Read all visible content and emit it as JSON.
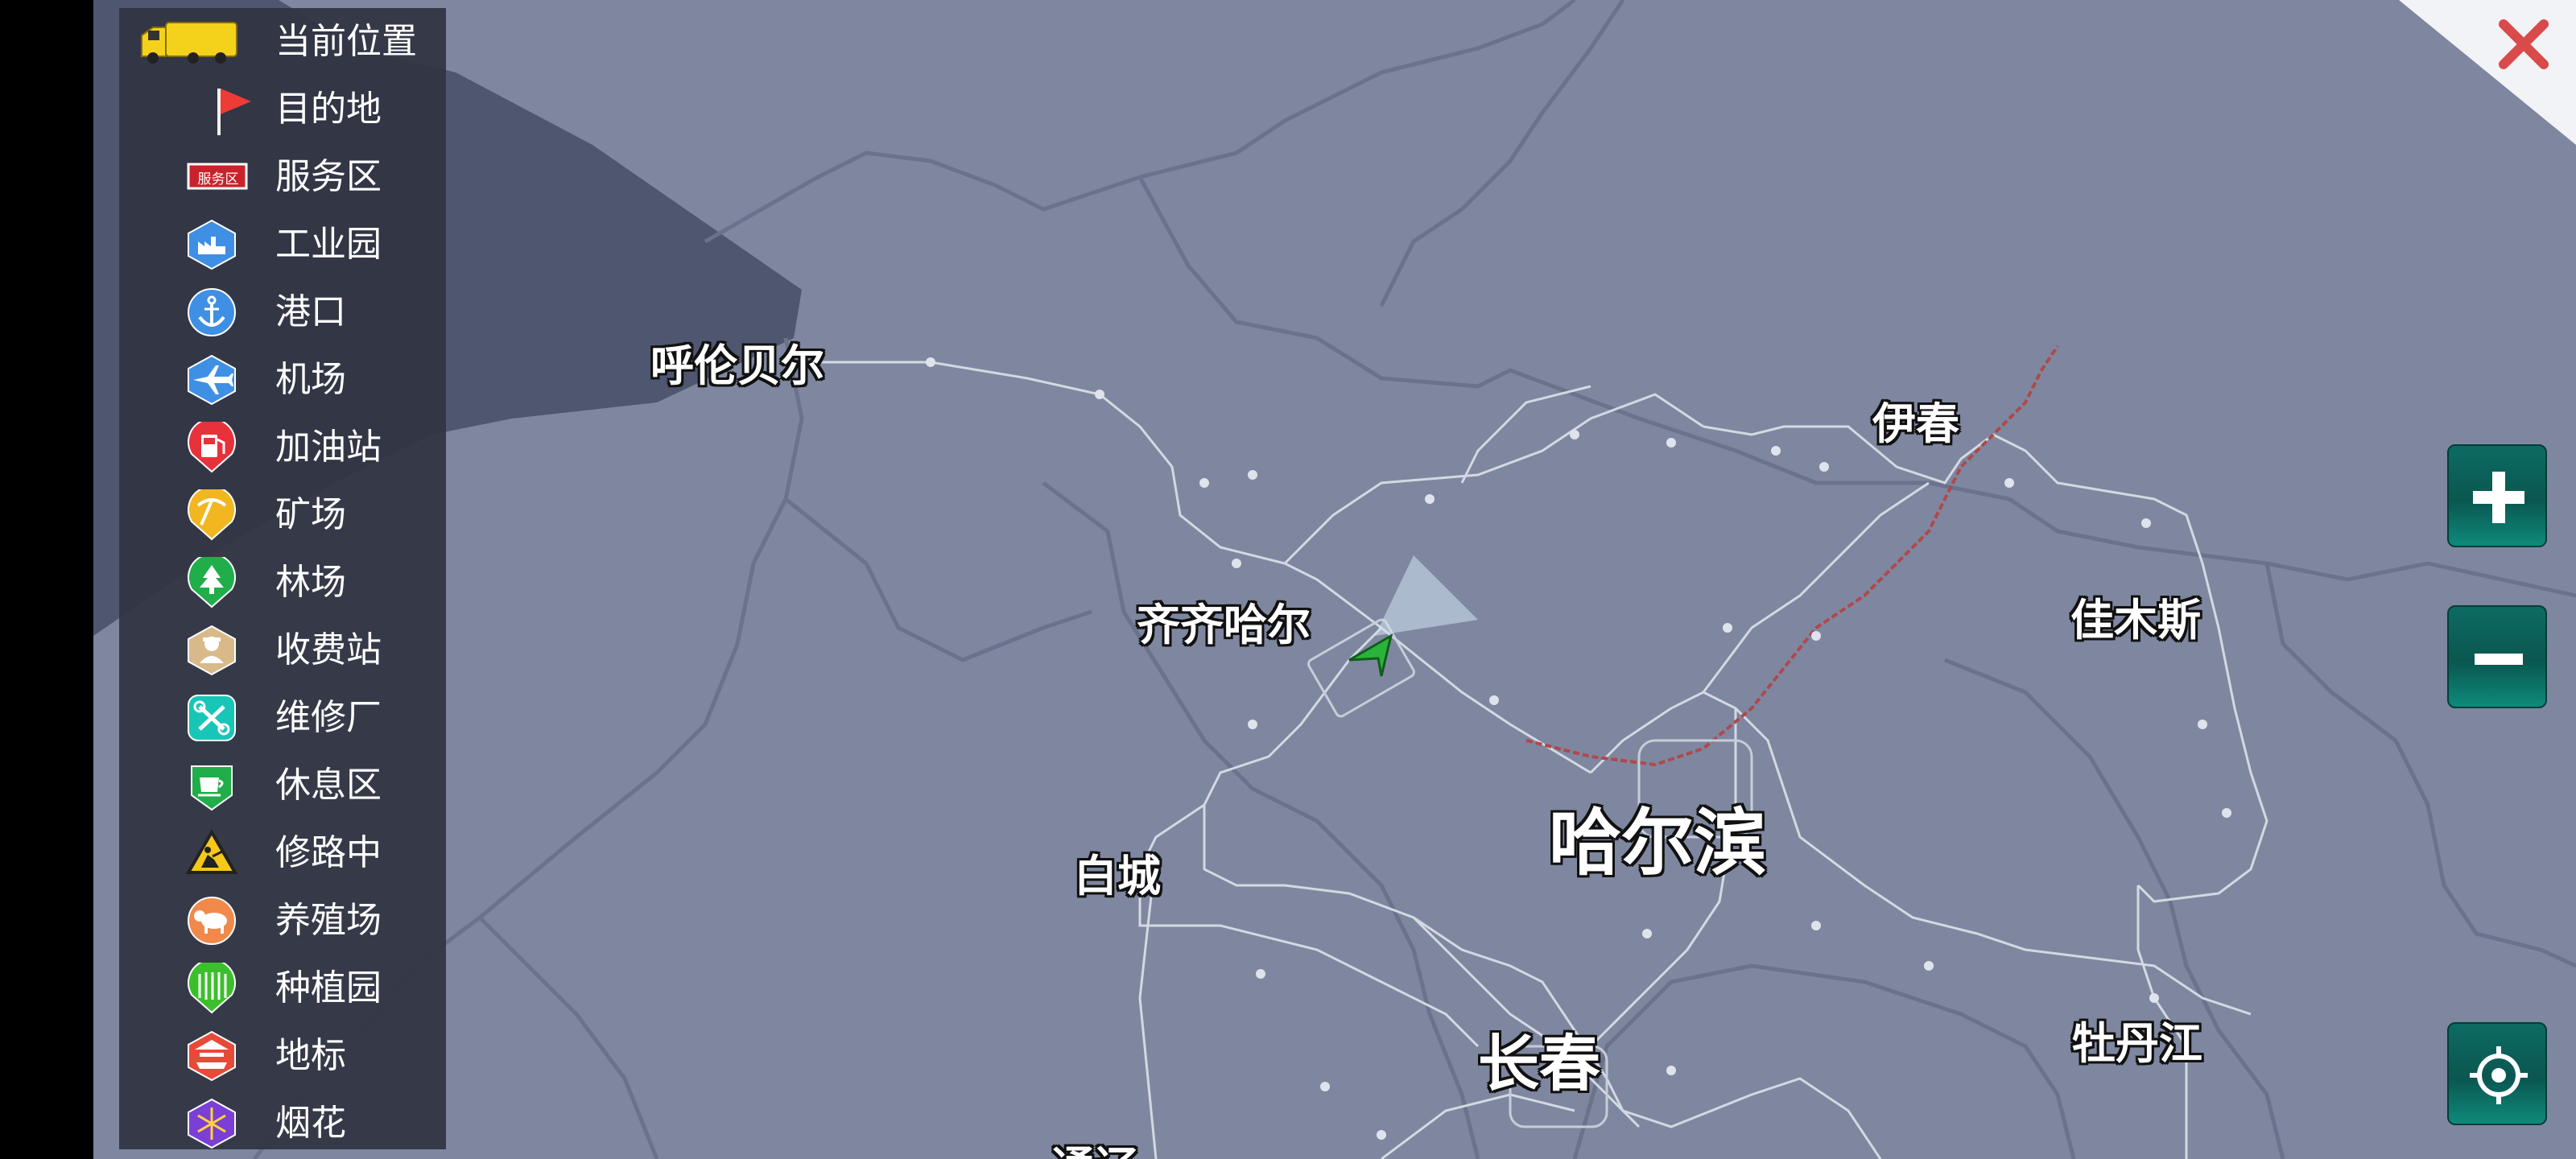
{
  "legend": {
    "items": [
      {
        "label": "当前位置",
        "icon": "truck-icon"
      },
      {
        "label": "目的地",
        "icon": "flag-icon"
      },
      {
        "label": "服务区",
        "icon": "service-area-sign-icon",
        "sign_text": "服务区"
      },
      {
        "label": "工业园",
        "icon": "factory-icon"
      },
      {
        "label": "港口",
        "icon": "anchor-icon"
      },
      {
        "label": "机场",
        "icon": "airplane-icon"
      },
      {
        "label": "加油站",
        "icon": "fuel-pump-icon"
      },
      {
        "label": "矿场",
        "icon": "pickaxe-icon"
      },
      {
        "label": "林场",
        "icon": "tree-icon"
      },
      {
        "label": "收费站",
        "icon": "toll-booth-icon"
      },
      {
        "label": "维修厂",
        "icon": "wrench-icon"
      },
      {
        "label": "休息区",
        "icon": "coffee-cup-icon"
      },
      {
        "label": "修路中",
        "icon": "road-work-icon"
      },
      {
        "label": "养殖场",
        "icon": "cow-icon"
      },
      {
        "label": "种植园",
        "icon": "crop-icon"
      },
      {
        "label": "地标",
        "icon": "landmark-icon"
      },
      {
        "label": "烟花",
        "icon": "fireworks-icon"
      }
    ]
  },
  "map": {
    "cities": {
      "hulunbuir": "呼伦贝尔",
      "qiqihar": "齐齐哈尔",
      "yichun": "伊春",
      "jiamusi": "佳木斯",
      "harbin": "哈尔滨",
      "baicheng": "白城",
      "changchun": "长春",
      "mudanjiang": "牡丹江",
      "partial_bottom": "通辽"
    }
  },
  "controls": {
    "zoom_in": "+",
    "zoom_out": "−",
    "locate_icon": "crosshair-icon",
    "close_icon": "close-icon"
  },
  "colors": {
    "map_bg": "#7e879f",
    "panel_bg": "#303442",
    "control_green": "#0a5750",
    "close_red": "#d94b4b",
    "route_red": "#b0484b"
  }
}
